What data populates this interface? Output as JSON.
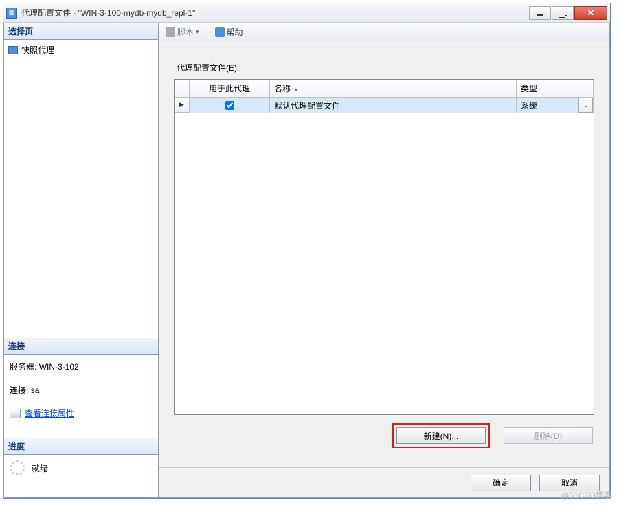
{
  "window": {
    "title": "代理配置文件 - \"WIN-3-100-mydb-mydb_repl-1\""
  },
  "left_panel": {
    "select_page_header": "选择页",
    "tree": {
      "snapshot_agent": "快照代理"
    },
    "connection_header": "连接",
    "server_label": "服务器:",
    "server_value": "WIN-3-102",
    "conn_label": "连接:",
    "conn_value": "sa",
    "view_conn_props": "查看连接属性",
    "progress_header": "进度",
    "ready_label": "就绪"
  },
  "toolbar": {
    "script_label": "脚本",
    "help_label": "帮助"
  },
  "content": {
    "profiles_label": "代理配置文件(E):",
    "columns": {
      "use_for_agent": "用于此代理",
      "name": "名称",
      "type": "类型"
    },
    "rows": [
      {
        "checked": true,
        "name": "默认代理配置文件",
        "type": "系统"
      }
    ],
    "new_button": "新建(N)...",
    "delete_button": "删除(D)"
  },
  "footer": {
    "ok": "确定",
    "cancel": "取消"
  },
  "watermark": "@51CTO博客"
}
